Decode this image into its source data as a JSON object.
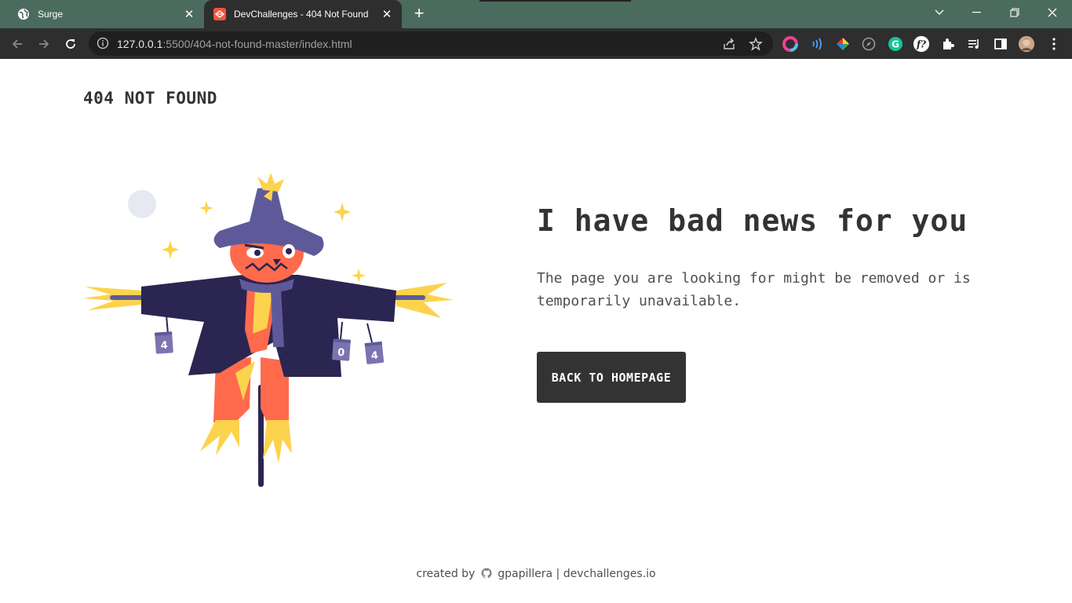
{
  "browser": {
    "tabs": [
      {
        "title": "Surge",
        "favicon": "globe-icon"
      },
      {
        "title": "DevChallenges - 404 Not Found",
        "favicon": "devchallenges-icon"
      }
    ],
    "url_host": "127.0.0.1",
    "url_rest": ":5500/404-not-found-master/index.html"
  },
  "page": {
    "brand": "404 NOT FOUND",
    "headline": "I have bad news for you",
    "description": "The page you are looking for might be removed or is temporarily unavailable.",
    "button": "BACK TO HOMEPAGE",
    "footer": {
      "prefix": "created by",
      "author": "gpapillera",
      "separator": "|",
      "site": "devchallenges.io"
    },
    "cans": [
      "4",
      "0",
      "4"
    ]
  },
  "colors": {
    "tabbar": "#4b6b5e",
    "chrome": "#2e2e2e",
    "text_dark": "#333333",
    "button_bg": "#333333",
    "scarecrow_purple": "#5e5a9a",
    "scarecrow_orange": "#ff6a4d",
    "straw_yellow": "#fcd34d",
    "coat_navy": "#2b2551"
  }
}
